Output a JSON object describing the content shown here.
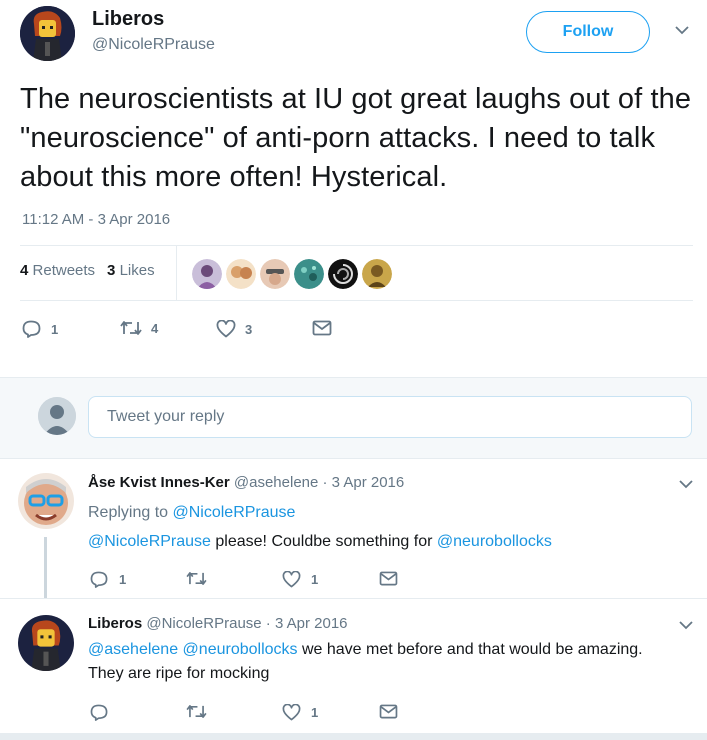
{
  "tweet": {
    "author_name": "Liberos",
    "author_handle": "@NicoleRPrause",
    "follow_label": "Follow",
    "text": "The neuroscientists at IU got great laughs out of the \"neuroscience\" of anti-porn attacks. I need to talk about this more often! Hysterical.",
    "timestamp": "11:12 AM - 3 Apr 2016",
    "retweets_count": "4",
    "retweets_label": "Retweets",
    "likes_count": "3",
    "likes_label": "Likes",
    "reply_count": "1",
    "retweet_count": "4",
    "like_count": "3"
  },
  "reply_box": {
    "placeholder": "Tweet your reply"
  },
  "replies": [
    {
      "name": "Åse Kvist Innes-Ker",
      "meta": "@asehelene · 3 Apr 2016",
      "replying_prefix": "Replying to",
      "replying_to": "@NicoleRPrause",
      "mention": "@NicoleRPrause",
      "text": " please! Couldbe something for ",
      "mention2": "@neurobollocks",
      "reply_count": "1",
      "like_count": "1"
    },
    {
      "name": "Liberos",
      "meta": "@NicoleRPrause · 3 Apr 2016",
      "mention": "@asehelene",
      "mention2": "@neurobollocks",
      "text": " we have met before and that would be amazing.",
      "text_line2": "They are ripe for mocking",
      "like_count": "1"
    }
  ],
  "colors": {
    "accent": "#1da1f2",
    "link": "#1b95e0",
    "muted": "#657786",
    "text": "#14171a",
    "background_alt": "#f5f8fa"
  }
}
